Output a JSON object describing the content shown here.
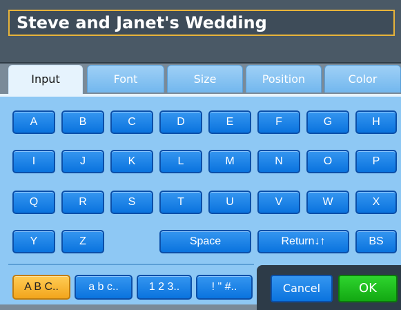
{
  "title": "Steve and Janet's Wedding",
  "tabs": [
    "Input",
    "Font",
    "Size",
    "Position",
    "Color"
  ],
  "active_tab": "Input",
  "keys": {
    "row1": [
      "A",
      "B",
      "C",
      "D",
      "E",
      "F",
      "G",
      "H"
    ],
    "row2": [
      "I",
      "J",
      "K",
      "L",
      "M",
      "N",
      "O",
      "P"
    ],
    "row3": [
      "Q",
      "R",
      "S",
      "T",
      "U",
      "V",
      "W",
      "X"
    ],
    "row4": [
      "Y",
      "Z"
    ],
    "space": "Space",
    "return": "Return↓↑",
    "backspace": "BS"
  },
  "modes": [
    "A B C..",
    "a b c..",
    "1 2 3..",
    "! \" #.."
  ],
  "active_mode": "A B C..",
  "actions": {
    "cancel": "Cancel",
    "ok": "OK"
  },
  "colors": {
    "key": "#0a73de",
    "active_mode": "#f2a51c",
    "ok": "#12a812",
    "title_border": "#e8b43a"
  }
}
